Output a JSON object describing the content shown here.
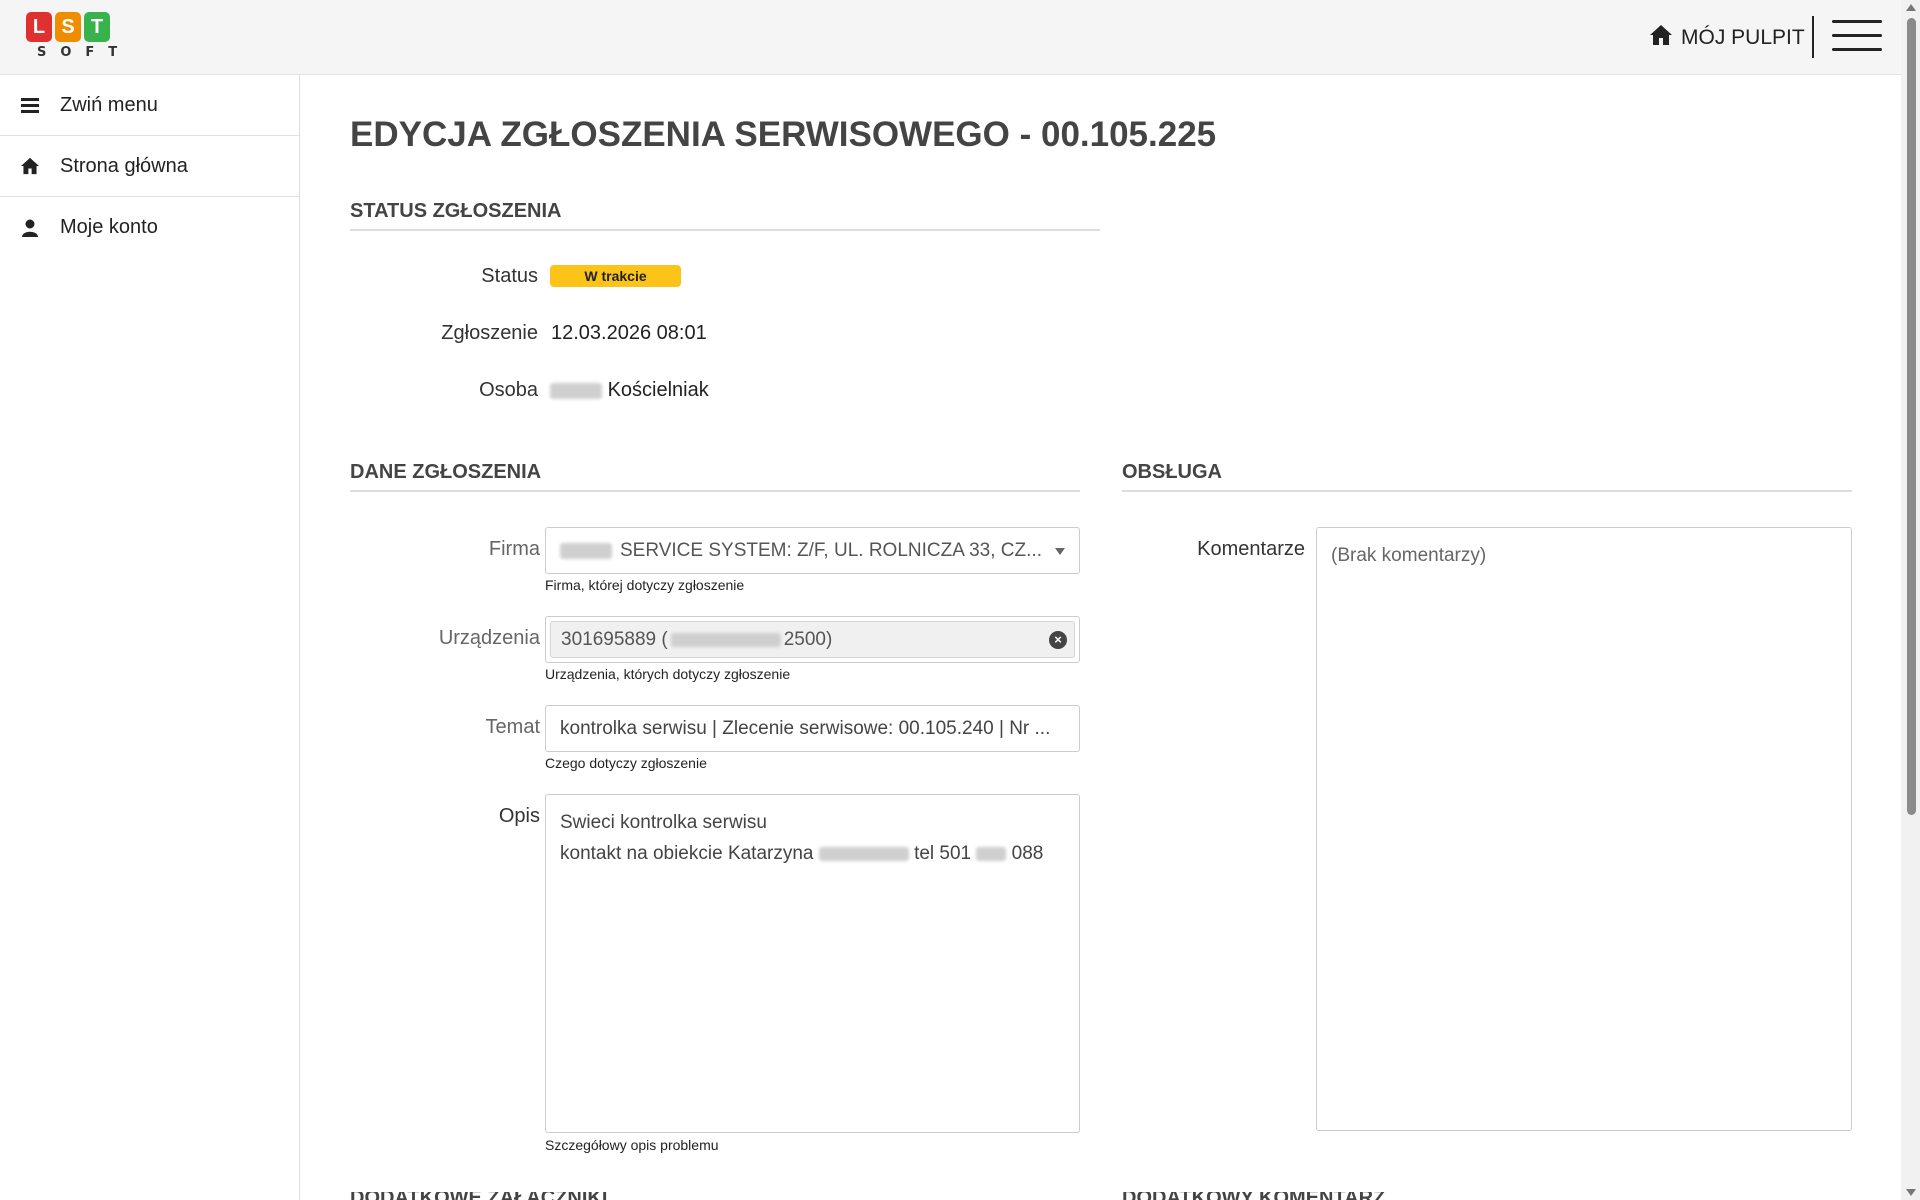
{
  "brand": {
    "logo_letters": [
      "L",
      "S",
      "T"
    ],
    "logo_colors": [
      "#e03131",
      "#f08c00",
      "#37b24d"
    ],
    "logo_subtitle": "SOFT"
  },
  "header": {
    "dashboard_icon": "home-icon",
    "dashboard_label": "MÓJ PULPIT",
    "menu_icon": "hamburger-icon"
  },
  "sidebar": {
    "items": [
      {
        "icon": "bars-icon",
        "label": "Zwiń menu"
      },
      {
        "icon": "home-icon",
        "label": "Strona główna"
      },
      {
        "icon": "user-icon",
        "label": "Moje konto"
      }
    ]
  },
  "page": {
    "title": "EDYCJA ZGŁOSZENIA SERWISOWEGO - 00.105.225"
  },
  "status_section": {
    "heading": "STATUS ZGŁOSZENIA",
    "status_label": "Status",
    "status_value": "W trakcie",
    "status_color": "#fcc419",
    "submitted_label": "Zgłoszenie",
    "submitted_value": "12.03.2026 08:01",
    "person_label": "Osoba",
    "person_value": "Kościelniak"
  },
  "details_section": {
    "heading": "DANE ZGŁOSZENIA",
    "company": {
      "label": "Firma",
      "value": "SERVICE SYSTEM: Z/F, UL. ROLNICZA 33, CZ...",
      "help": "Firma, której dotyczy zgłoszenie"
    },
    "devices": {
      "label": "Urządzenia",
      "value_prefix": "301695889 (",
      "value_suffix": "2500)",
      "help": "Urządzenia, których dotyczy zgłoszenie"
    },
    "subject": {
      "label": "Temat",
      "value": "kontrolka serwisu | Zlecenie serwisowe: 00.105.240 | Nr ...",
      "help": "Czego dotyczy zgłoszenie"
    },
    "description": {
      "label": "Opis",
      "line1": "Swieci kontrolka serwisu",
      "line2_a": "kontakt na obiekcie Katarzyna",
      "line2_b": "tel 501",
      "line2_c": "088",
      "help": "Szczegółowy opis problemu"
    }
  },
  "service_section": {
    "heading": "OBSŁUGA",
    "comments_label": "Komentarze",
    "comments_placeholder": "(Brak komentarzy)"
  },
  "below_fold": {
    "left_heading": "DODATKOWE ZAŁĄCZNIKI",
    "right_heading": "DODATKOWY KOMENTARZ"
  }
}
